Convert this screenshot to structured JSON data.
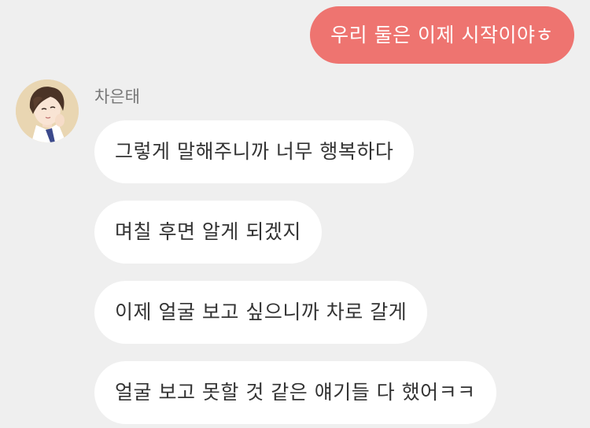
{
  "outgoing": {
    "text": "우리 둘은 이제 시작이야ㅎ"
  },
  "sender": {
    "name": "차은태",
    "avatar_icon": "person-illustration-avatar"
  },
  "incoming": [
    {
      "text": "그렇게 말해주니까 너무 행복하다"
    },
    {
      "text": "며칠 후면 알게 되겠지"
    },
    {
      "text": "이제 얼굴 보고 싶으니까 차로 갈게"
    },
    {
      "text": "얼굴 보고 못할 것 같은 얘기들 다 했어ㅋㅋ"
    }
  ],
  "colors": {
    "background": "#efefef",
    "outgoing_bubble": "#ee7470",
    "incoming_bubble": "#ffffff"
  }
}
